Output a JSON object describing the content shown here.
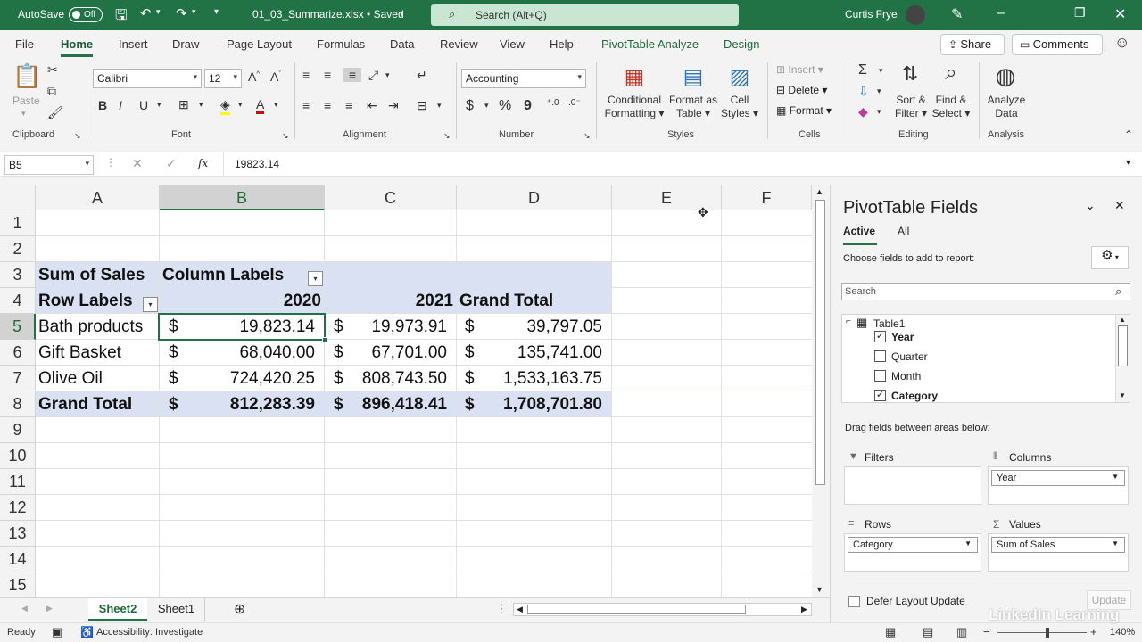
{
  "titlebar": {
    "autosave_label": "AutoSave",
    "autosave_state": "Off",
    "filename": "01_03_Summarize.xlsx • Saved",
    "search_placeholder": "Search (Alt+Q)",
    "user_name": "Curtis Frye"
  },
  "tabs": [
    "File",
    "Home",
    "Insert",
    "Draw",
    "Page Layout",
    "Formulas",
    "Data",
    "Review",
    "View",
    "Help",
    "PivotTable Analyze",
    "Design"
  ],
  "active_tab": "Home",
  "share_label": "Share",
  "comments_label": "Comments",
  "ribbon": {
    "clipboard": {
      "label": "Clipboard",
      "paste": "Paste"
    },
    "font": {
      "label": "Font",
      "name": "Calibri",
      "size": "12"
    },
    "alignment": {
      "label": "Alignment"
    },
    "number": {
      "label": "Number",
      "format": "Accounting"
    },
    "styles": {
      "label": "Styles",
      "conditional": [
        "Conditional",
        "Formatting"
      ],
      "format_table": [
        "Format as",
        "Table"
      ],
      "cell_styles": [
        "Cell",
        "Styles"
      ]
    },
    "cells": {
      "label": "Cells",
      "insert": "Insert",
      "delete": "Delete",
      "format": "Format"
    },
    "editing": {
      "label": "Editing",
      "sort": [
        "Sort &",
        "Filter"
      ],
      "find": [
        "Find &",
        "Select"
      ]
    },
    "analysis": {
      "label": "Analysis",
      "analyze": [
        "Analyze",
        "Data"
      ]
    }
  },
  "formula_bar": {
    "name_box": "B5",
    "fx": "fx",
    "formula": "19823.14"
  },
  "columns": [
    "A",
    "B",
    "C",
    "D",
    "E",
    "F"
  ],
  "rows": [
    "1",
    "2",
    "3",
    "4",
    "5",
    "6",
    "7",
    "8",
    "9",
    "10",
    "11",
    "12",
    "13",
    "14",
    "15"
  ],
  "pivot": {
    "sum_label": "Sum of Sales",
    "col_labels": "Column Labels",
    "row_labels": "Row Labels",
    "year1": "2020",
    "year2": "2021",
    "grand_total_hdr": "Grand Total",
    "currency": "$",
    "data": [
      {
        "label": "Bath products",
        "v2020": "19,823.14",
        "v2021": "19,973.91",
        "total": "39,797.05"
      },
      {
        "label": "Gift Basket",
        "v2020": "68,040.00",
        "v2021": "67,701.00",
        "total": "135,741.00"
      },
      {
        "label": "Olive Oil",
        "v2020": "724,420.25",
        "v2021": "808,743.50",
        "total": "1,533,163.75"
      }
    ],
    "grand": {
      "label": "Grand Total",
      "v2020": "812,283.39",
      "v2021": "896,418.41",
      "total": "1,708,701.80"
    }
  },
  "sheets": [
    "Sheet2",
    "Sheet1"
  ],
  "active_sheet": "Sheet2",
  "status": {
    "ready": "Ready",
    "accessibility": "Accessibility: Investigate",
    "zoom": "140%"
  },
  "pane": {
    "title": "PivotTable Fields",
    "tab_active": "Active",
    "tab_all": "All",
    "choose": "Choose fields to add to report:",
    "search_placeholder": "Search",
    "table_name": "Table1",
    "fields": [
      {
        "name": "Year",
        "checked": true
      },
      {
        "name": "Quarter",
        "checked": false
      },
      {
        "name": "Month",
        "checked": false
      },
      {
        "name": "Category",
        "checked": true
      }
    ],
    "drag_hint": "Drag fields between areas below:",
    "filters": "Filters",
    "columns": "Columns",
    "columns_value": "Year",
    "rows": "Rows",
    "rows_value": "Category",
    "values": "Values",
    "values_value": "Sum of Sales",
    "defer": "Defer Layout Update",
    "update": "Update"
  },
  "watermark": "LinkedIn Learning"
}
